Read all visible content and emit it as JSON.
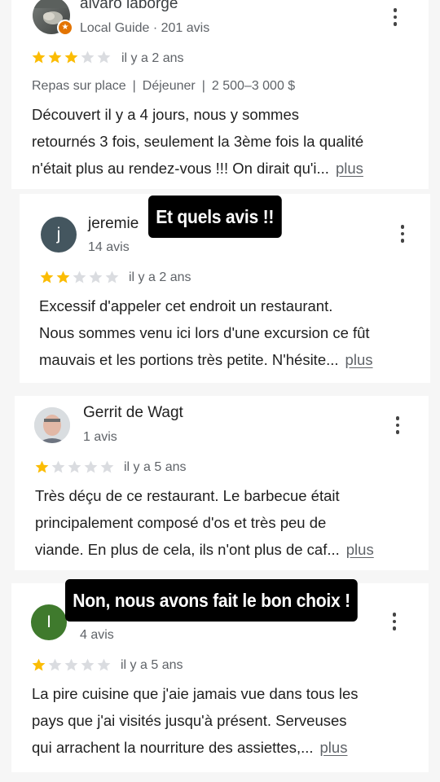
{
  "reviews": [
    {
      "name": "alvaro laborge",
      "meta": "Local Guide · 201 avis",
      "rating": 3,
      "when": "il y a 2 ans",
      "tags": [
        "Repas sur place",
        "Déjeuner",
        "2 500–3 000 $"
      ],
      "lines": [
        "Découvert il y a 4 jours,  nous y sommes",
        "retournés 3 fois, seulement la 3ème fois la qualité",
        "n'était plus au rendez-vous !!!  On dirait qu'i..."
      ],
      "more_label": "plus"
    },
    {
      "name": "jeremie",
      "avatar_letter": "j",
      "meta": "14 avis",
      "rating": 2,
      "when": "il y a 2 ans",
      "lines": [
        "Excessif d'appeler cet endroit un restaurant.",
        "Nous sommes venu ici lors d'une excursion ce fût",
        "mauvais et les portions très petite. N'hésite..."
      ],
      "more_label": "plus"
    },
    {
      "name": "Gerrit de Wagt",
      "meta": "1 avis",
      "rating": 1,
      "when": "il y a 5 ans",
      "lines": [
        "Très déçu de ce restaurant. Le barbecue était",
        "principalement composé d'os et très peu de",
        "viande. En plus de cela, ils n'ont plus de caf..."
      ],
      "more_label": "plus"
    },
    {
      "avatar_letter": "I",
      "meta": "4 avis",
      "rating": 1,
      "when": "il y a 5 ans",
      "lines": [
        "La pire cuisine que j'aie jamais vue dans tous les",
        "pays que j'ai visités jusqu'à présent. Serveuses",
        "qui arrachent la nourriture des assiettes,..."
      ],
      "more_label": "plus"
    }
  ],
  "overlays": {
    "first": "Et quels avis !!",
    "second": "Non, nous avons fait le bon choix !"
  },
  "colors": {
    "star_filled": "#fbbc04",
    "star_empty": "#dadce0",
    "avatar_jeremie": "#44565f",
    "avatar_i": "#3f7a2d",
    "local_guide_badge": "#e37400"
  }
}
